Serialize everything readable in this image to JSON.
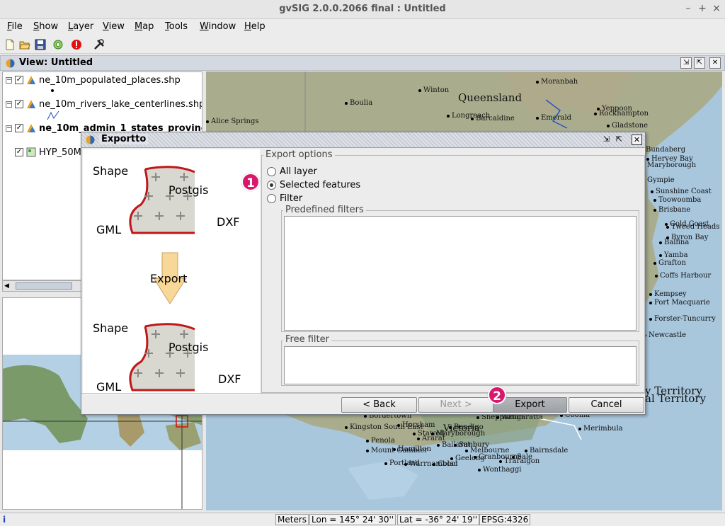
{
  "window": {
    "title": "gvSIG 2.0.0.2066 final : Untitled",
    "controls": [
      "–",
      "+",
      "×"
    ]
  },
  "menubar": [
    {
      "label": "File",
      "mnemonic": "F",
      "rest": "ile"
    },
    {
      "label": "Show",
      "mnemonic": "S",
      "rest": "how"
    },
    {
      "label": "Layer",
      "mnemonic": "L",
      "rest": "ayer"
    },
    {
      "label": "View",
      "mnemonic": "V",
      "rest": "iew"
    },
    {
      "label": "Map",
      "mnemonic": "M",
      "rest": "ap"
    },
    {
      "label": "Tools",
      "mnemonic": "T",
      "rest": "ools"
    },
    {
      "label": "Window",
      "mnemonic": "W",
      "rest": "indow"
    },
    {
      "label": "Help",
      "mnemonic": "H",
      "rest": "elp"
    }
  ],
  "toolbar": {
    "icons": [
      "new-document-icon",
      "open-folder-icon",
      "save-icon",
      "settings-icon",
      "error-icon",
      "tools-icon"
    ]
  },
  "view": {
    "title": "View: Untitled",
    "layers": [
      {
        "name": "ne_10m_populated_places.shp",
        "bold": false
      },
      {
        "name": "ne_10m_rivers_lake_centerlines.shp",
        "bold": false
      },
      {
        "name": "ne_10m_admin_1_states_provinc",
        "bold": true
      },
      {
        "name": "HYP_50M",
        "bold": false
      }
    ]
  },
  "map": {
    "region_labels": {
      "queensland": "Queensland",
      "victoria": "Victoria",
      "territory1": "y Territory",
      "territory2": "al Territory"
    },
    "places": [
      "Moranbah",
      "Winton",
      "Boulia",
      "Alice Springs",
      "Longreach",
      "Barcaldine",
      "Emerald",
      "Yeppoon",
      "Rockhampton",
      "Gladstone",
      "Bundaberg",
      "Hervey Bay",
      "Maryborough",
      "Gympie",
      "Sunshine Coast",
      "Toowoomba",
      "Brisbane",
      "Gold Coast",
      "Tweed Heads",
      "Byron Bay",
      "Ballina",
      "Yamba",
      "Grafton",
      "Coffs Harbour",
      "Kempsey",
      "Port Macquarie",
      "Forster-Tuncurry",
      "Newcastle",
      "Bordertown",
      "Horsham",
      "Kingston South East",
      "Stawell",
      "Maryborough",
      "Bendigo",
      "Shepparton",
      "Wangaratta",
      "Penola",
      "Ararat",
      "Mount Gambier",
      "Hamilton",
      "Ballarat",
      "Portland",
      "Warrnambool",
      "Colac",
      "Geelong",
      "Melbourne",
      "Sunbury",
      "Cranbourne",
      "Sale",
      "Traralgon",
      "Wonthaggi",
      "Bairnsdale",
      "Merimbula",
      "Cooma"
    ]
  },
  "status": {
    "units": "Meters",
    "lon": "Lon = 145° 24' 30''",
    "lat": "Lat = -36° 24' 19''",
    "epsg": "EPSG:4326",
    "info_icon": "i"
  },
  "dialog": {
    "title": "Exportto",
    "illustration": {
      "shape": "Shape",
      "postgis": "Postgis",
      "gml": "GML",
      "dxf": "DXF",
      "export": "Export"
    },
    "export_options": {
      "label": "Export options",
      "options": [
        "All layer",
        "Selected features",
        "Filter"
      ],
      "selected": "Selected features"
    },
    "predefined_filters": {
      "label": "Predefined filters"
    },
    "free_filter": {
      "label": "Free filter"
    },
    "buttons": {
      "back": "< Back",
      "next": "Next >",
      "export": "Export",
      "cancel": "Cancel"
    }
  },
  "callouts": [
    "1",
    "2"
  ],
  "colors": {
    "callout": "#d8186c",
    "accent_shape": "#c01818",
    "map_water": "#a8c6dc",
    "map_land": "#a8b090"
  }
}
